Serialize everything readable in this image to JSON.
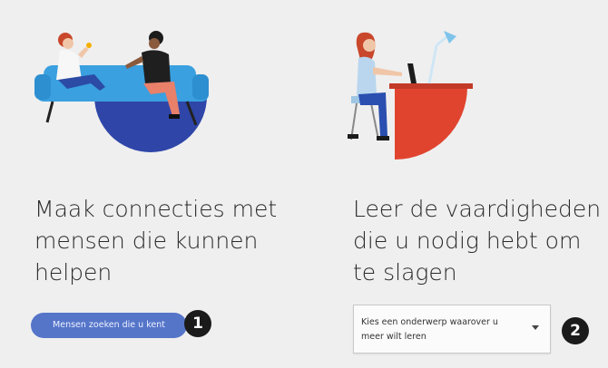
{
  "connect": {
    "heading": "Maak connecties met\nmensen die kunnen\nhelpen",
    "button_label": "Mensen zoeken die u kent",
    "badge": "1"
  },
  "learn": {
    "heading": "Leer de vaardigheden\ndie u nodig hebt om\nte slagen",
    "select_value": "Kies een onderwerp waarover u meer wilt leren",
    "badge": "2"
  },
  "colors": {
    "button": "#5575c9",
    "navy_circle": "#2f46a8",
    "sofa_blue": "#3aa0e0",
    "desk_red": "#e0442f",
    "badge": "#1b1b1b",
    "background": "#efefef"
  },
  "icons": {
    "select_chevron": "chevron-down-icon"
  }
}
